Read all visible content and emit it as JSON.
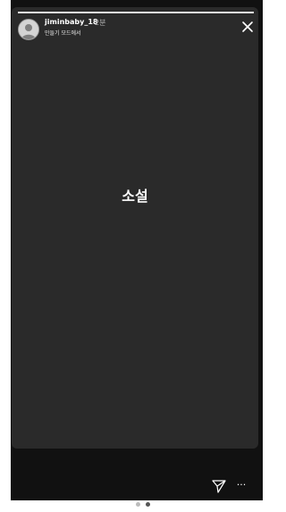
{
  "story": {
    "username": "jiminbaby_18",
    "time": "2분",
    "subtitle": "만들기 모드에서",
    "text": "소설",
    "progress": 1.0
  },
  "icons": {
    "close": "close-icon",
    "send": "send-icon",
    "more": "more-icon",
    "avatar": "avatar"
  },
  "actions": {
    "more_label": "···"
  },
  "pagination": {
    "total": 2,
    "active": 2
  },
  "colors": {
    "story_background": "#2a2a2a",
    "screen_background": "#111111",
    "text": "#ffffff"
  }
}
